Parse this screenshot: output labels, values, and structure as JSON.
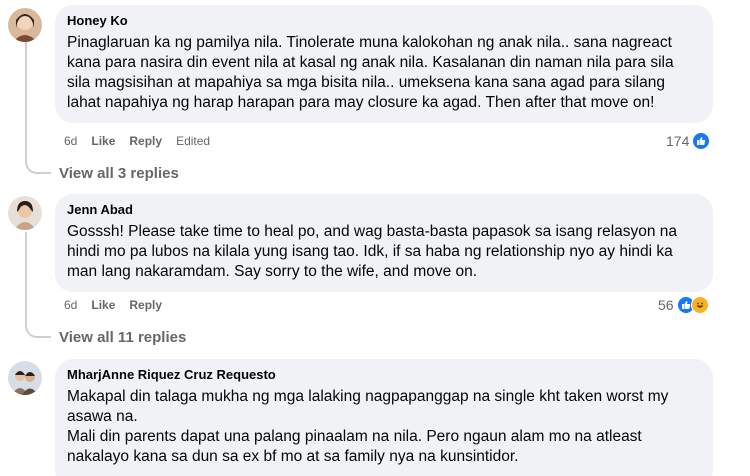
{
  "comments": [
    {
      "author": "Honey Ko",
      "text": "Pinaglaruan ka ng pamilya nila. Tinolerate muna kalokohan ng anak nila.. sana nagreact kana para nasira din event nila at kasal ng anak nila. Kasalanan din naman nila para sila sila magsisihan at mapahiya sa mga bisita nila.. umeksena kana sana agad para silang lahat napahiya ng harap harapan para may closure ka agad. Then after that move on!",
      "time": "6d",
      "like_label": "Like",
      "reply_label": "Reply",
      "edited_label": "Edited",
      "reaction_count": "174",
      "reaction_icons": [
        "like-icon"
      ],
      "view_replies": "View all 3 replies"
    },
    {
      "author": "Jenn Abad",
      "text": "Gosssh! Please take time to heal po, and wag basta-basta papasok sa isang relasyon na hindi mo pa lubos na kilala yung isang tao. Idk, if sa haba ng relationship nyo ay hindi ka man lang nakaramdam. Say sorry to the wife, and move on.",
      "time": "6d",
      "like_label": "Like",
      "reply_label": "Reply",
      "reaction_count": "56",
      "reaction_icons": [
        "like-icon",
        "haha-icon"
      ],
      "view_replies": "View all 11 replies"
    },
    {
      "author": "MharjAnne Riquez Cruz Requesto",
      "text": "Makapal din talaga mukha ng mga lalaking nagpapanggap na single kht taken worst my asawa na.\nMali din parents dapat una palang pinaalam na nila. Pero ngaun alam mo na atleast nakalayo kana sa dun sa ex bf mo at sa family nya na kunsintidor."
    }
  ],
  "colors": {
    "bubble": "#f0f2f5",
    "meta_text": "#65676b",
    "like_blue": "#1877f2",
    "haha_yellow": "#f7b125",
    "thread_line": "#ccd0d5"
  }
}
